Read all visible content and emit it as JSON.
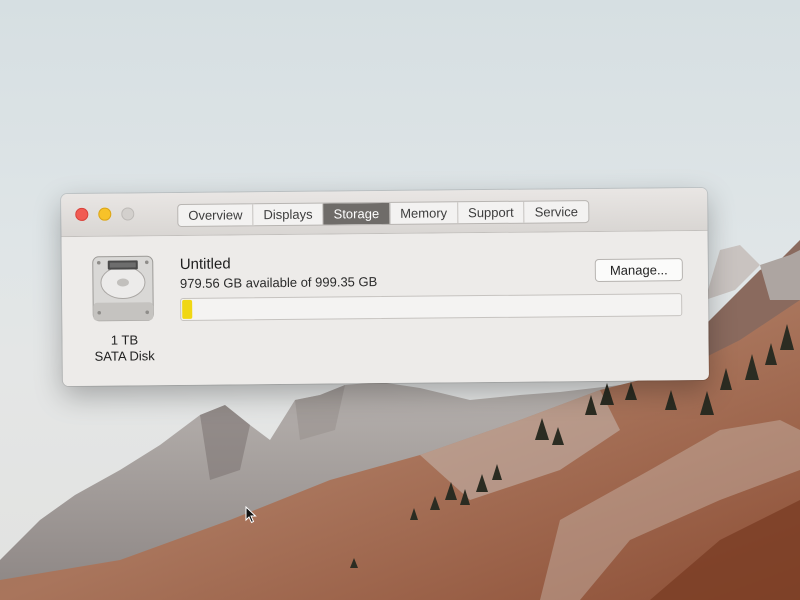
{
  "window": {
    "tabs": [
      {
        "label": "Overview",
        "active": false
      },
      {
        "label": "Displays",
        "active": false
      },
      {
        "label": "Storage",
        "active": true
      },
      {
        "label": "Memory",
        "active": false
      },
      {
        "label": "Support",
        "active": false
      },
      {
        "label": "Service",
        "active": false
      }
    ]
  },
  "disk": {
    "capacity_label": "1 TB",
    "type_label": "SATA Disk",
    "icon": "hard-drive-icon"
  },
  "volume": {
    "name": "Untitled",
    "availability": "979.56 GB available of 999.35 GB",
    "used_fraction": 0.0198,
    "used_color": "#f0d714"
  },
  "buttons": {
    "manage": "Manage..."
  },
  "colors": {
    "close": "#f15b53",
    "minimize": "#f7c229",
    "zoom_disabled": "#d3d0cd",
    "active_tab": "#6f6c69"
  }
}
